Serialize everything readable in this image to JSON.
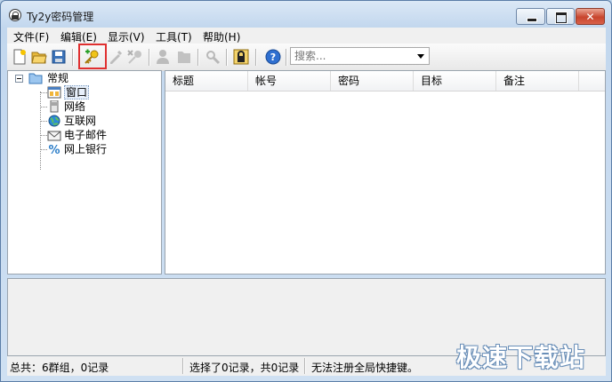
{
  "window": {
    "title": "Ty2y密码管理"
  },
  "menu": [
    "文件(F)",
    "编辑(E)",
    "显示(V)",
    "工具(T)",
    "帮助(H)"
  ],
  "toolbar": {
    "search_placeholder": "搜索..."
  },
  "tree": {
    "root": "常规",
    "children": [
      "窗口",
      "网络",
      "互联网",
      "电子邮件",
      "网上银行"
    ]
  },
  "list": {
    "columns": [
      "标题",
      "帐号",
      "密码",
      "目标",
      "备注"
    ]
  },
  "status": {
    "total": "总共：6群组，0记录",
    "selected": "选择了0记录，共0记录",
    "hotkey": "无法注册全局快捷键。"
  },
  "watermark": "极速下载站",
  "colors": {
    "accent": "#e03030",
    "titlebar": "#c2d7ee",
    "selected_bg": "#e8f0fb"
  }
}
